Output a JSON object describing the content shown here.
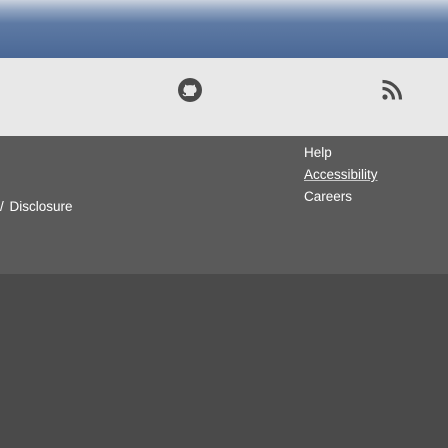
{
  "icons": {
    "github": "github-icon",
    "rss": "rss-icon"
  },
  "footer": {
    "links": {
      "help": "Help",
      "accessibility": "Accessibility",
      "careers": "Careers"
    },
    "left_link": "Disclosure",
    "separator": "/"
  },
  "colors": {
    "header_band": "#4a6896",
    "icon_bar": "#e8e8e8",
    "footer_dark": "#5a5a5a",
    "bottom_band": "#4a4a4a",
    "icon_color": "#4a4a4a"
  }
}
